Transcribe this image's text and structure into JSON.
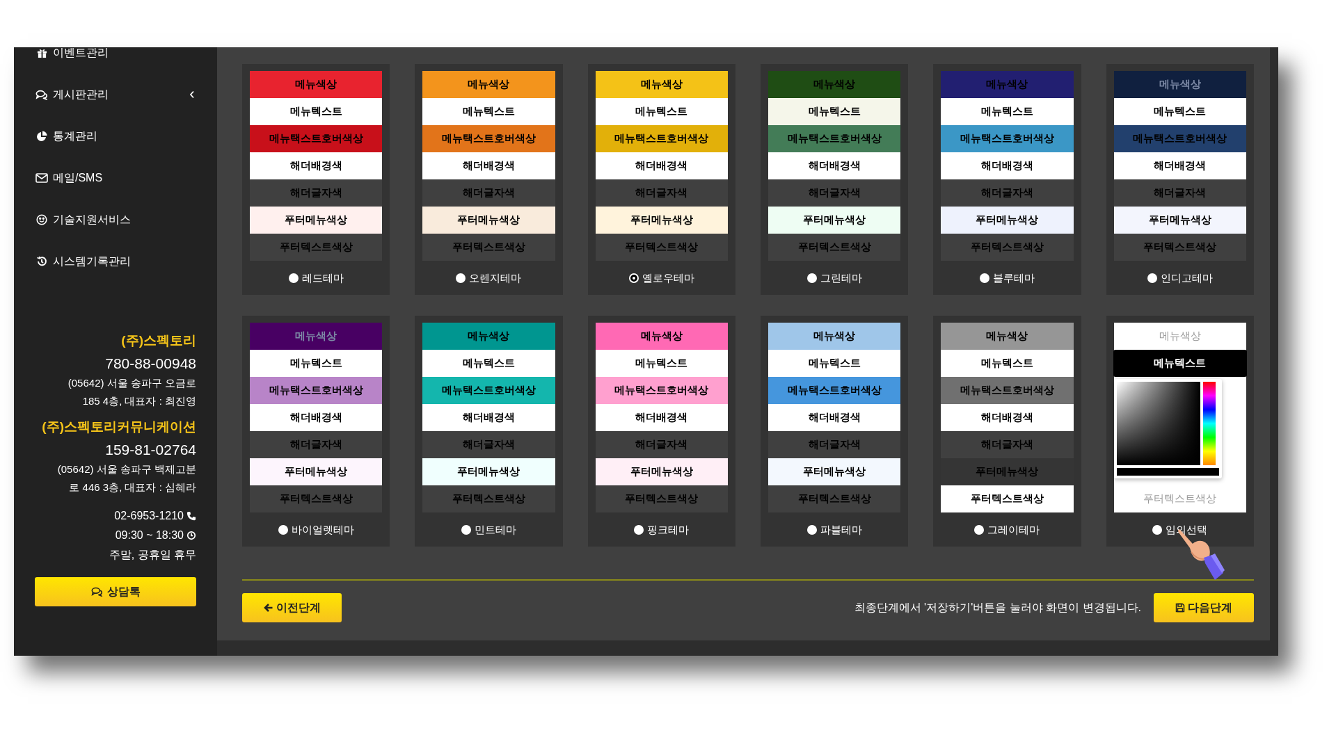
{
  "sidebar": {
    "menu": [
      {
        "label": "이벤트관리",
        "has_submenu": false
      },
      {
        "label": "게시판관리",
        "has_submenu": true
      },
      {
        "label": "통계관리",
        "has_submenu": false
      },
      {
        "label": "메일/SMS",
        "has_submenu": false
      },
      {
        "label": "기술지원서비스",
        "has_submenu": false
      },
      {
        "label": "시스템기록관리",
        "has_submenu": false
      }
    ],
    "companies": [
      {
        "name": "(주)스펙토리",
        "reg_no": "780-88-00948",
        "address_lines": [
          "(05642) 서울 송파구 오금로",
          "185 4층, 대표자 : 최진영"
        ]
      },
      {
        "name": "(주)스펙토리커뮤니케이션",
        "reg_no": "159-81-02764",
        "address_lines": [
          "(05642) 서울 송파구 백제고분",
          "로 446 3층, 대표자 : 심혜라"
        ]
      }
    ],
    "phone": "02-6953-1210",
    "hours": "09:30 ~ 18:30",
    "closed": "주말, 공휴일 휴무",
    "consult_button": "상담톡"
  },
  "themes": [
    {
      "name": "레드테마",
      "selected": false,
      "kind": "preset",
      "swatches": [
        {
          "label": "메뉴색상",
          "color": "#e8232f"
        },
        {
          "label": "메뉴텍스트",
          "color": "#ffffff"
        },
        {
          "label": "메뉴택스트호버색상",
          "color": "#c8101a"
        },
        {
          "label": "해더배경색",
          "color": "#ffffff"
        },
        {
          "label": "해더글자색",
          "color": "#404040"
        },
        {
          "label": "푸터메뉴색상",
          "color": "#fff0ee"
        },
        {
          "label": "푸터텍스트색상",
          "color": "#404040"
        }
      ]
    },
    {
      "name": "오렌지테마",
      "selected": false,
      "kind": "preset",
      "swatches": [
        {
          "label": "메뉴색상",
          "color": "#f3941c"
        },
        {
          "label": "메뉴텍스트",
          "color": "#ffffff"
        },
        {
          "label": "메뉴택스트호버색상",
          "color": "#e2741a"
        },
        {
          "label": "해더배경색",
          "color": "#ffffff"
        },
        {
          "label": "해더글자색",
          "color": "#404040"
        },
        {
          "label": "푸터메뉴색상",
          "color": "#f9ebdc"
        },
        {
          "label": "푸터텍스트색상",
          "color": "#404040"
        }
      ]
    },
    {
      "name": "옐로우테마",
      "selected": true,
      "kind": "preset",
      "swatches": [
        {
          "label": "메뉴색상",
          "color": "#f4c217"
        },
        {
          "label": "메뉴텍스트",
          "color": "#ffffff"
        },
        {
          "label": "메뉴택스트호버색상",
          "color": "#e2b00a"
        },
        {
          "label": "해더배경색",
          "color": "#ffffff"
        },
        {
          "label": "해더글자색",
          "color": "#404040"
        },
        {
          "label": "푸터메뉴색상",
          "color": "#fff3dc"
        },
        {
          "label": "푸터텍스트색상",
          "color": "#404040"
        }
      ]
    },
    {
      "name": "그린테마",
      "selected": false,
      "kind": "preset",
      "swatches": [
        {
          "label": "메뉴색상",
          "color": "#1f4d14"
        },
        {
          "label": "메뉴텍스트",
          "color": "#f5f6ea"
        },
        {
          "label": "메뉴택스트호버색상",
          "color": "#437c57"
        },
        {
          "label": "해더배경색",
          "color": "#ffffff"
        },
        {
          "label": "해더글자색",
          "color": "#404040"
        },
        {
          "label": "푸터메뉴색상",
          "color": "#eefdf3"
        },
        {
          "label": "푸터텍스트색상",
          "color": "#404040"
        }
      ]
    },
    {
      "name": "블루테마",
      "selected": false,
      "kind": "preset",
      "swatches": [
        {
          "label": "메뉴색상",
          "color": "#221f71"
        },
        {
          "label": "메뉴텍스트",
          "color": "#ffffff"
        },
        {
          "label": "메뉴택스트호버색상",
          "color": "#3b97c6"
        },
        {
          "label": "해더배경색",
          "color": "#ffffff"
        },
        {
          "label": "해더글자색",
          "color": "#404040"
        },
        {
          "label": "푸터메뉴색상",
          "color": "#eef2fd"
        },
        {
          "label": "푸터텍스트색상",
          "color": "#404040"
        }
      ]
    },
    {
      "name": "인디고테마",
      "selected": false,
      "kind": "preset",
      "swatches": [
        {
          "label": "메뉴색상",
          "color": "#10203f"
        },
        {
          "label": "메뉴텍스트",
          "color": "#ffffff"
        },
        {
          "label": "메뉴택스트호버색상",
          "color": "#22406d"
        },
        {
          "label": "해더배경색",
          "color": "#ffffff"
        },
        {
          "label": "해더글자색",
          "color": "#404040"
        },
        {
          "label": "푸터메뉴색상",
          "color": "#f3f5fd"
        },
        {
          "label": "푸터텍스트색상",
          "color": "#404040"
        }
      ]
    },
    {
      "name": "바이얼렛테마",
      "selected": false,
      "kind": "preset",
      "swatches": [
        {
          "label": "메뉴색상",
          "color": "#480063"
        },
        {
          "label": "메뉴텍스트",
          "color": "#ffffff"
        },
        {
          "label": "메뉴택스트호버색상",
          "color": "#b884c8"
        },
        {
          "label": "해더배경색",
          "color": "#ffffff"
        },
        {
          "label": "해더글자색",
          "color": "#404040"
        },
        {
          "label": "푸터메뉴색상",
          "color": "#fdf5fd"
        },
        {
          "label": "푸터텍스트색상",
          "color": "#404040"
        }
      ]
    },
    {
      "name": "민트테마",
      "selected": false,
      "kind": "preset",
      "swatches": [
        {
          "label": "메뉴색상",
          "color": "#009690"
        },
        {
          "label": "메뉴텍스트",
          "color": "#ffffff"
        },
        {
          "label": "메뉴택스트호버색상",
          "color": "#14b6ad"
        },
        {
          "label": "해더배경색",
          "color": "#ffffff"
        },
        {
          "label": "해더글자색",
          "color": "#404040"
        },
        {
          "label": "푸터메뉴색상",
          "color": "#f0fffe"
        },
        {
          "label": "푸터텍스트색상",
          "color": "#404040"
        }
      ]
    },
    {
      "name": "핑크테마",
      "selected": false,
      "kind": "preset",
      "swatches": [
        {
          "label": "메뉴색상",
          "color": "#ff69b4"
        },
        {
          "label": "메뉴텍스트",
          "color": "#ffffff"
        },
        {
          "label": "메뉴택스트호버색상",
          "color": "#ffa0cf"
        },
        {
          "label": "해더배경색",
          "color": "#ffffff"
        },
        {
          "label": "해더글자색",
          "color": "#404040"
        },
        {
          "label": "푸터메뉴색상",
          "color": "#ffeff6"
        },
        {
          "label": "푸터텍스트색상",
          "color": "#404040"
        }
      ]
    },
    {
      "name": "파블테마",
      "selected": false,
      "kind": "preset",
      "swatches": [
        {
          "label": "메뉴색상",
          "color": "#9fc6e9"
        },
        {
          "label": "메뉴텍스트",
          "color": "#ffffff"
        },
        {
          "label": "메뉴택스트호버색상",
          "color": "#4596dd"
        },
        {
          "label": "해더배경색",
          "color": "#ffffff"
        },
        {
          "label": "해더글자색",
          "color": "#404040"
        },
        {
          "label": "푸터메뉴색상",
          "color": "#f3f8fe"
        },
        {
          "label": "푸터텍스트색상",
          "color": "#404040"
        }
      ]
    },
    {
      "name": "그레이테마",
      "selected": false,
      "kind": "preset",
      "swatches": [
        {
          "label": "메뉴색상",
          "color": "#969696"
        },
        {
          "label": "메뉴텍스트",
          "color": "#ffffff"
        },
        {
          "label": "메뉴택스트호버색상",
          "color": "#707070"
        },
        {
          "label": "해더배경색",
          "color": "#ffffff"
        },
        {
          "label": "해더글자색",
          "color": "#404040"
        },
        {
          "label": "푸터메뉴색상",
          "color": "#353535"
        },
        {
          "label": "푸터텍스트색상",
          "color": "#ffffff"
        }
      ]
    },
    {
      "name": "임의선택",
      "selected": false,
      "kind": "custom",
      "swatches": [
        {
          "label": "메뉴색상",
          "color": "#ffffff",
          "kind": "swatch"
        },
        {
          "label": "메뉴텍스트",
          "color": "#000000",
          "kind": "picker"
        },
        {
          "label": "푸터텍스트색상",
          "color": "#ffffff",
          "kind": "swatch"
        }
      ]
    }
  ],
  "footer": {
    "prev_button": "이전단계",
    "notice": "최종단계에서 '저장하기'버튼을 눌러야 화면이 변경됩니다.",
    "next_button": "다음단계"
  }
}
